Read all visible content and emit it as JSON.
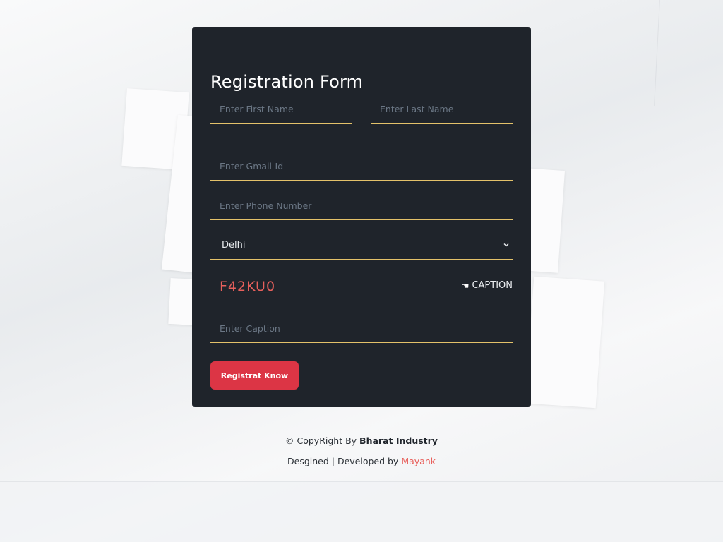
{
  "form": {
    "title": "Registration Form",
    "first_name_placeholder": "Enter First Name",
    "last_name_placeholder": "Enter Last Name",
    "email_placeholder": "Enter Gmail-Id",
    "phone_placeholder": "Enter Phone Number",
    "city_selected": "Delhi",
    "captcha_code": "F42KU0",
    "captcha_button_label": "CAPTION",
    "caption_placeholder": "Enter Caption",
    "submit_label": "Registrat Know"
  },
  "footer": {
    "copyright_prefix": "© CopyRight By",
    "company": "Bharat Industry",
    "credit_prefix": "Desgined | Developed by",
    "developer": "Mayank"
  },
  "colors": {
    "card_bg": "#1f242b",
    "accent_underline": "#e3c26a",
    "button": "#dc3545",
    "captcha_text": "#e8605c"
  }
}
